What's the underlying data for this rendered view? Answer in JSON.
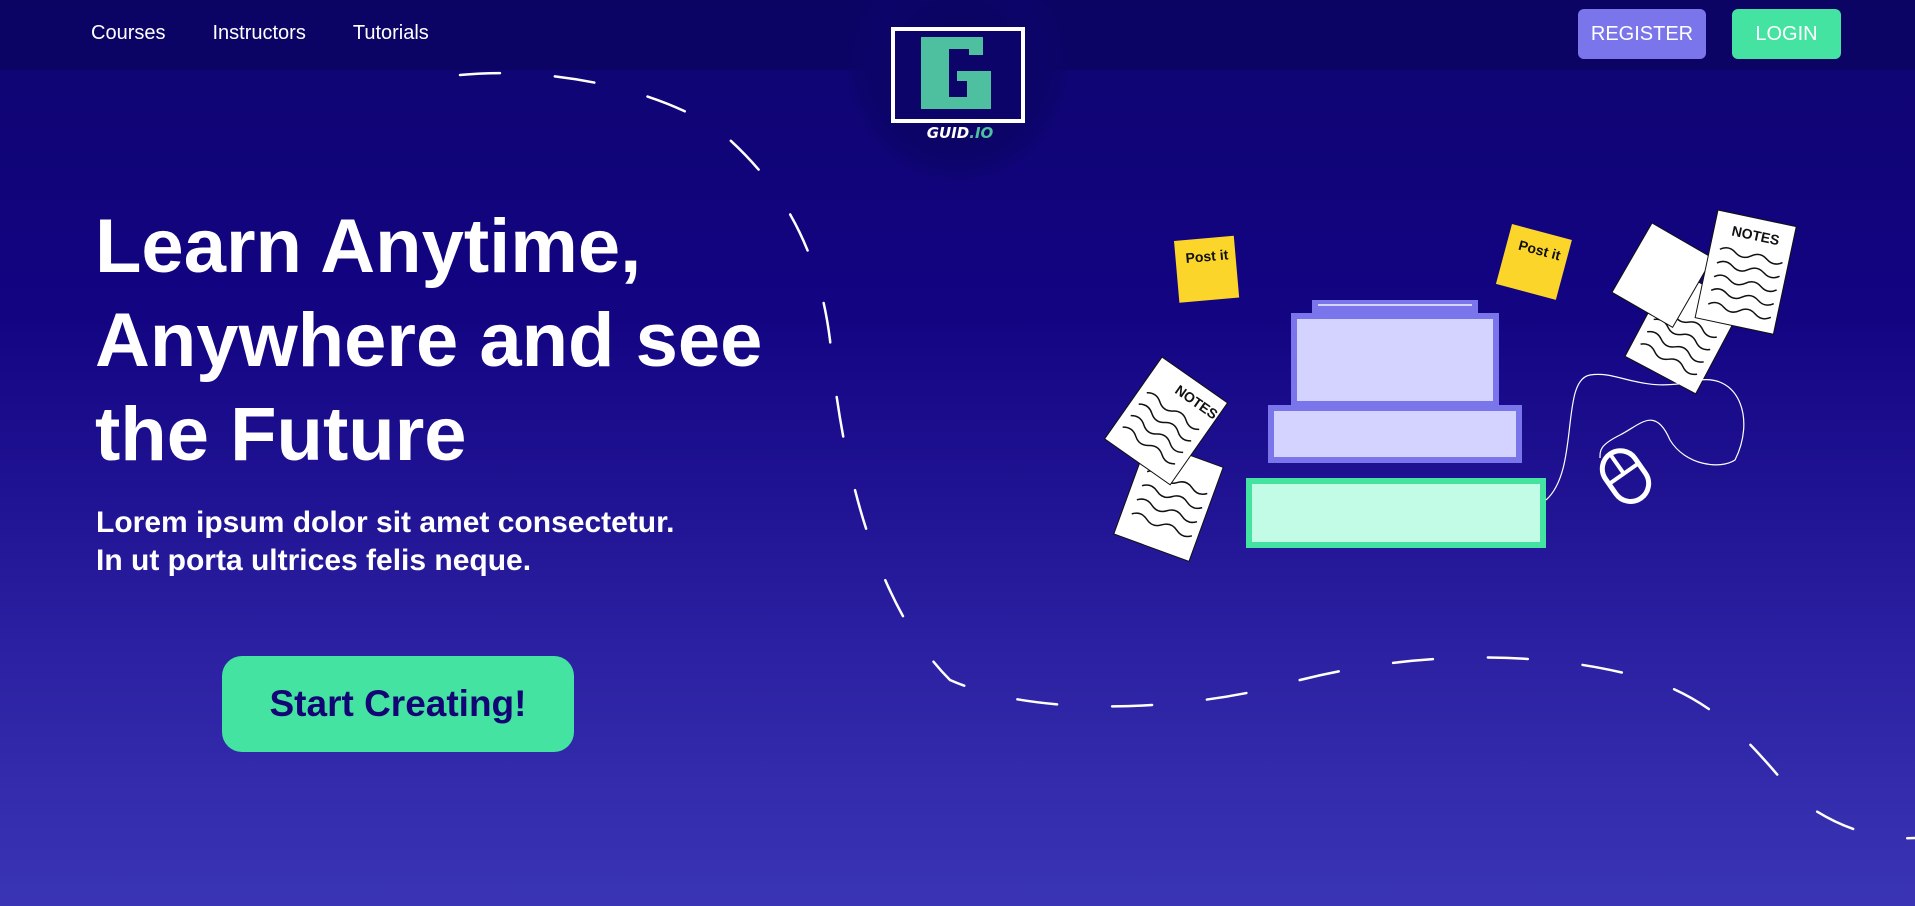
{
  "nav": {
    "items": [
      {
        "label": "Courses"
      },
      {
        "label": "Instructors"
      },
      {
        "label": "Tutorials"
      }
    ]
  },
  "logo": {
    "text_main": "GUID",
    "text_suffix": ".IO"
  },
  "auth": {
    "register_label": "REGISTER",
    "login_label": "LOGIN"
  },
  "hero": {
    "title": "Learn Anytime,\nAnywhere and see\nthe Future",
    "subtitle": "Lorem ipsum dolor sit amet consectetur.\nIn ut porta ultrices felis neque.",
    "cta_label": "Start Creating!"
  },
  "illustration": {
    "postit_label": "Post it",
    "notes_label": "NOTES"
  },
  "colors": {
    "background_top": "#0e0570",
    "background_bottom": "#3a35b5",
    "accent_green": "#45e3a2",
    "accent_purple": "#7b75ec",
    "postit_yellow": "#fbd52a"
  },
  "icons": [
    "logo-g-icon",
    "mouse-icon",
    "postit-note-icon",
    "notes-paper-icon"
  ]
}
